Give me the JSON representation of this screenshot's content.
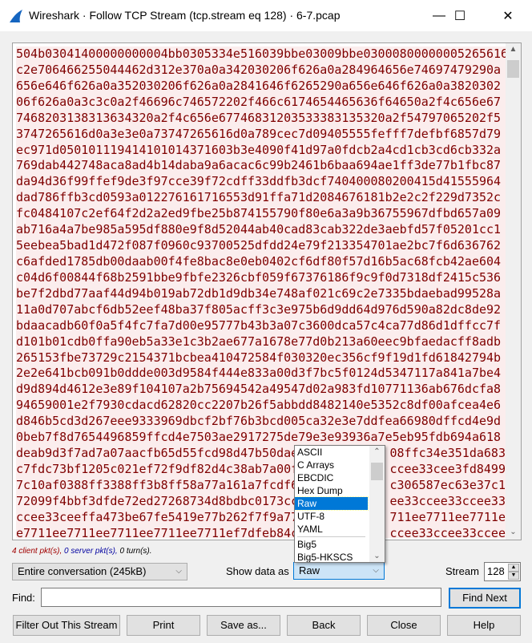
{
  "window": {
    "title": "Wireshark · Follow TCP Stream (tcp.stream eq 128) · 6-7.pcap",
    "minimize": "—",
    "maximize": "☐",
    "close": "✕"
  },
  "colors": {
    "client_text": "#7f0000",
    "client_bg": "#fbeded",
    "accent": "#0078d7"
  },
  "stream_lines": [
    {
      "l": "504b03041400000000004bb0305334e516039bbe03009bbe03000800000005265616"
    },
    {
      "l": "c2e706466255044462d312e370a0a342030206f626a0a284964656e74697479290a"
    },
    {
      "l": "656e646f626a0a352030206f626a0a2841646f6265290a656e646f626a0a3820302"
    },
    {
      "l": "06f626a0a3c3c0a2f46696c746572202f466c6174654465636f64650a2f4c656e67"
    },
    {
      "l": "7468203138313634320a2f4c656e67746831203533383135320a2f54797065202f5"
    },
    {
      "l": "3747265616d0a3e3e0a73747265616d0a789cec7d09405555fefff7defbf6857d79"
    },
    {
      "l": "ec971d050101119414101014371603b3e4090f41d97a0fdcb2a4cd1cb3cd6cb332a"
    },
    {
      "l": "769dab442748aca8ad4b14daba9a6acac6c99b2461b6baa694ae1ff3de77b1fbc87"
    },
    {
      "l": "da94d36f99ffef9de3f97cce39f72cdff33ddfb3dcf740400080200415d41555964"
    },
    {
      "l": "dad786ffb3cd0593a012276161716553d91ffa71d2084676181b2e2c2f229d7352c"
    },
    {
      "l": "fc0484107c2ef64f2d2a2ed9fbe25b874155790f80e6a3a9b36755967dfbd657a09"
    },
    {
      "l": "ab716a4a7be985a595df880e9f8d52044ab40cad83cab322de3aebfd57f05201cc1"
    },
    {
      "l": "5eebea5bad1d472f087f0960c93700525dfdd24e79f213354701ae2bc7f6d636762"
    },
    {
      "l": "c6afded1785db00daab00f4fe8bac8e0eb0402cf6df80f57d16b5ac68fcb42ae604"
    },
    {
      "l": "c04d6f00844f68b2591bbe9fbfe2326cbf059f67376186f9c9f0d7318df2415c536"
    },
    {
      "l": "be7f2dbd77aaf44d94b019ab72db1d9db34e748af021c69c2e7335bdaebad99528a"
    },
    {
      "l": "11a0d707abcf6db52eef48ba37f805acff3c3e975b6d9dd64d976d590a82dc8de92"
    },
    {
      "l": "bdaacadb60f0a5f4fc7fa7d00e95777b43b3a07c3600dca57c4ca77d86d1dffcc7f"
    },
    {
      "l": "d101b01cdb0ffa90eb5a33e1c3b2ae677a1678e77d0b213a60eec9bfaedacff8adb"
    },
    {
      "l": "265153fbe73729c2154371bcbea410472584f030320ec356cf9f19d1fd61842794b"
    },
    {
      "l": "2e2e641bcb091b0ddde003d9584f444e833a00d3f7bc5f0124d5347117a841a7be4"
    },
    {
      "l": "d9d894d4612e3e89f104107a2b75694542a49547d02a983fd10771136ab676dcfa8"
    },
    {
      "l": "94659001e2f7930cdacd62820cc2207b26f5abbdd8482140e5352c8df00afcea4e6"
    },
    {
      "l": "d846b5cd3d267eee9333969dbcf2bf76b3bcd005ca32e3e7ddfea66980dffcd4e9d"
    },
    {
      "l": "0beb7f8d7654496859ffcd4e7503ae2917275de79e3e93936a7e5eb95fdb694a618"
    },
    {
      "l": "deab9d3f7ad7a07aacfb65d55fcd98d47b50dae",
      "r": "08ffc34e351da683"
    },
    {
      "l": "c7fdc73bf1205c021ef72f9df82d4c38ab7a00f",
      "r": "ccee33cee3fd8499"
    },
    {
      "l": "7c10af0388ff3388ff3b8ff58a77a161a7fcdf6",
      "r": "c306587ec63e37c1"
    },
    {
      "l": "72099f4bbf3dfde72ed27268734d8bdbc0173cc",
      "r": "ee33ccee33ccee33"
    },
    {
      "l": "ccee33ceeffa473be67fe5419e77b262f7f9a77",
      "r": "711ee7711ee7711e"
    },
    {
      "l": "e7711ee7711ee7711ee7711ee7711ef7dfeb84c",
      "r": "ccee33ccee33ccee"
    }
  ],
  "status": {
    "client": "4 client pkt(s),",
    "server": "0 server pkt(s),",
    "turns": "0 turn(s)."
  },
  "conversation": {
    "value": "Entire conversation (245kB)"
  },
  "show_data": {
    "label": "Show data as",
    "value": "Raw",
    "options": [
      "ASCII",
      "C Arrays",
      "EBCDIC",
      "Hex Dump",
      "Raw",
      "UTF-8",
      "YAML",
      "Big5",
      "Big5-HKSCS"
    ]
  },
  "stream": {
    "label": "Stream",
    "value": "128"
  },
  "find": {
    "label": "Find:",
    "value": "",
    "next": "Find Next"
  },
  "buttons": {
    "filter_out": "Filter Out This Stream",
    "print": "Print",
    "save_as": "Save as...",
    "back": "Back",
    "close": "Close",
    "help": "Help"
  }
}
